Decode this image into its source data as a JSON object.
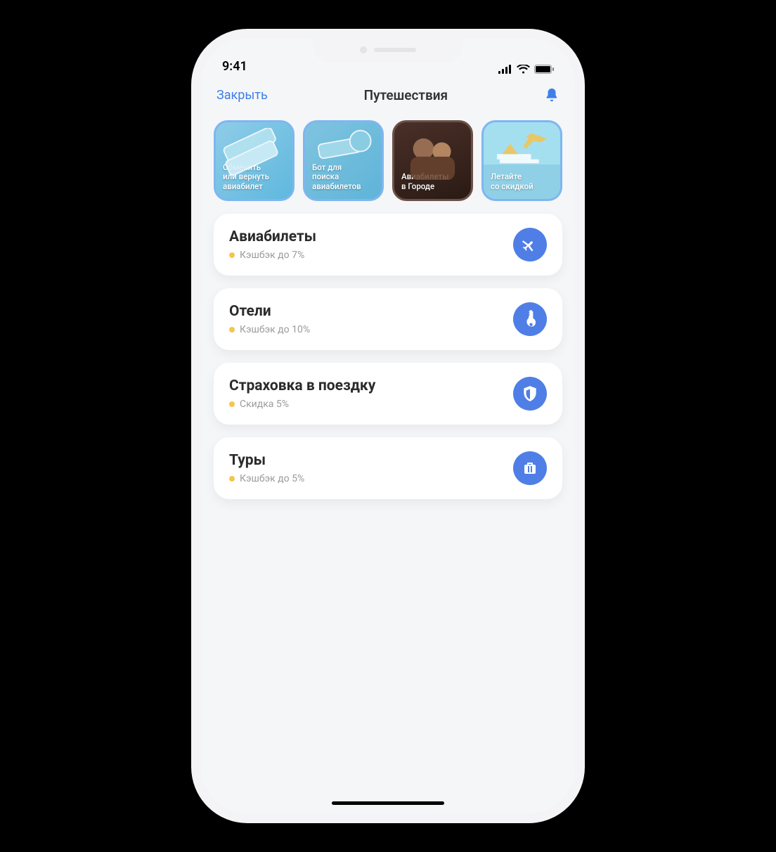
{
  "status": {
    "time": "9:41"
  },
  "nav": {
    "close": "Закрыть",
    "title": "Путешествия"
  },
  "stories": [
    {
      "label": "Обменять\nили вернуть\nавиабилет"
    },
    {
      "label": "Бот для\nпоиска\nавиабилетов"
    },
    {
      "label": "Авиабилеты\nв Городе"
    },
    {
      "label": "Летайте\nсо скидкой"
    }
  ],
  "cards": [
    {
      "title": "Авиабилеты",
      "sub": "Кэшбэк до 7%",
      "icon": "plane"
    },
    {
      "title": "Отели",
      "sub": "Кэшбэк до 10%",
      "icon": "key"
    },
    {
      "title": "Страховка в поездку",
      "sub": "Скидка 5%",
      "icon": "shield"
    },
    {
      "title": "Туры",
      "sub": "Кэшбэк до 5%",
      "icon": "suitcase"
    }
  ]
}
